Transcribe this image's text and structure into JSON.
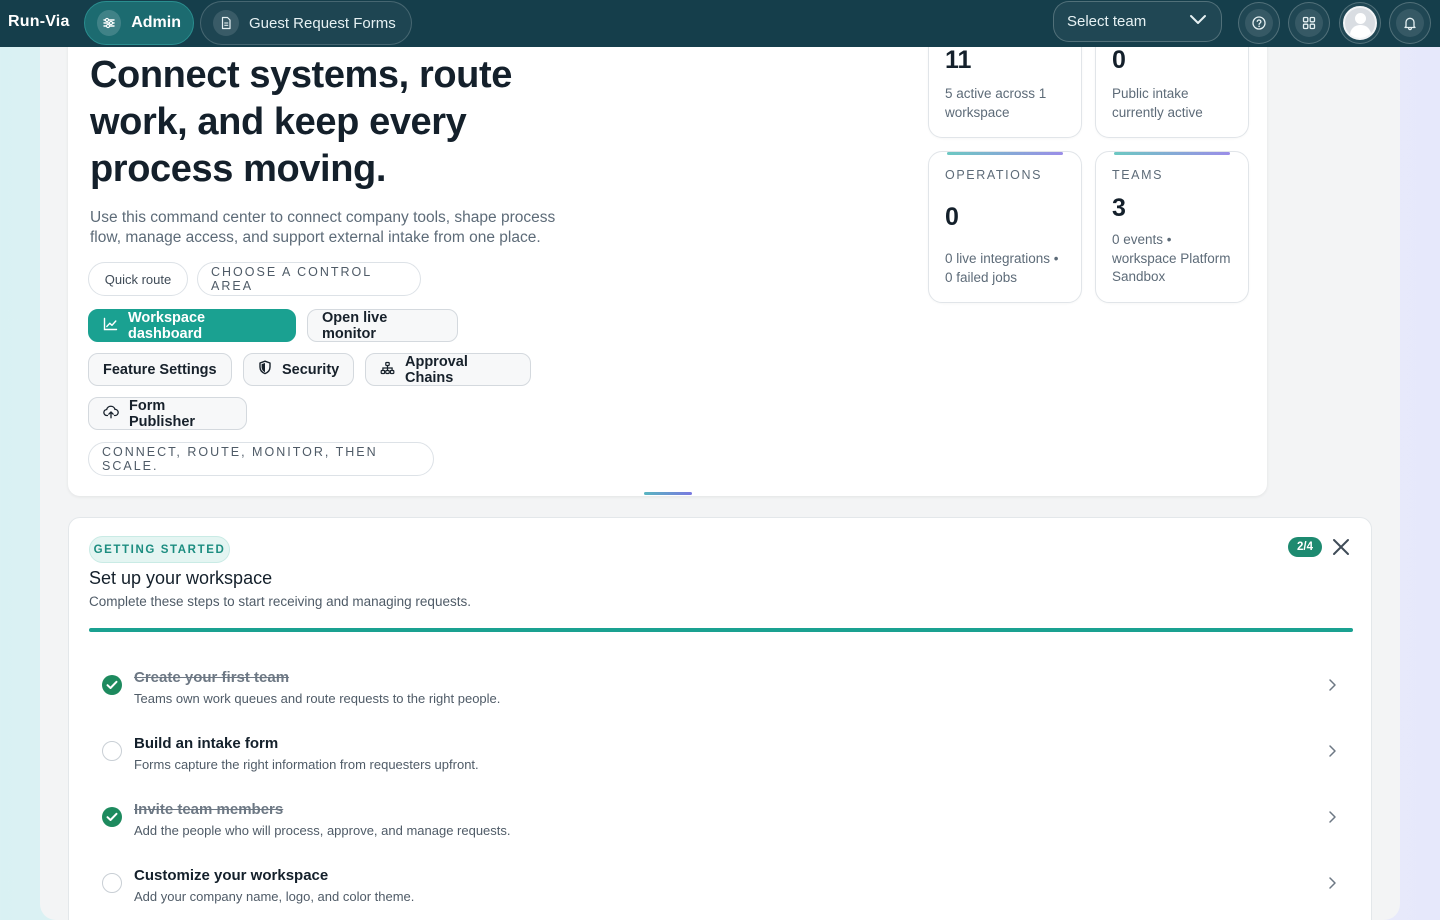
{
  "brand": "Run-Via",
  "nav": {
    "admin": "Admin",
    "guest_forms": "Guest Request Forms"
  },
  "team_select": {
    "placeholder": "Select team"
  },
  "hero": {
    "title": "Connect systems, route work, and keep every process moving.",
    "subtitle": "Use this command center to connect company tools, shape process flow, manage access, and support external intake from one place.",
    "quick_route": "Quick route",
    "choose_area": "CHOOSE A CONTROL AREA",
    "workspace_dashboard": "Workspace dashboard",
    "open_live_monitor": "Open live monitor",
    "feature_settings": "Feature Settings",
    "security": "Security",
    "approval_chains": "Approval Chains",
    "form_publisher": "Form Publisher",
    "tagline": "CONNECT, ROUTE, MONITOR, THEN SCALE."
  },
  "stats": [
    {
      "label": "",
      "value": "11",
      "desc": "5 active across 1 workspace"
    },
    {
      "label": "",
      "value": "0",
      "desc": "Public intake currently active"
    },
    {
      "label": "OPERATIONS",
      "value": "0",
      "desc": "0 live integrations • 0 failed jobs"
    },
    {
      "label": "TEAMS",
      "value": "3",
      "desc": "0 events • workspace Platform Sandbox"
    }
  ],
  "getting_started": {
    "badge": "GETTING STARTED",
    "title": "Set up your workspace",
    "subtitle": "Complete these steps to start receiving and managing requests.",
    "count": "2/4",
    "progress": 1.0,
    "steps": [
      {
        "title": "Create your first team",
        "desc": "Teams own work queues and route requests to the right people.",
        "done": true
      },
      {
        "title": "Build an intake form",
        "desc": "Forms capture the right information from requesters upfront.",
        "done": false
      },
      {
        "title": "Invite team members",
        "desc": "Add the people who will process, approve, and manage requests.",
        "done": true
      },
      {
        "title": "Customize your workspace",
        "desc": "Add your company name, logo, and color theme.",
        "done": false
      }
    ]
  },
  "colors": {
    "topbar": "#153e4b",
    "accent": "#1aa191",
    "done": "#1d8a5e"
  }
}
